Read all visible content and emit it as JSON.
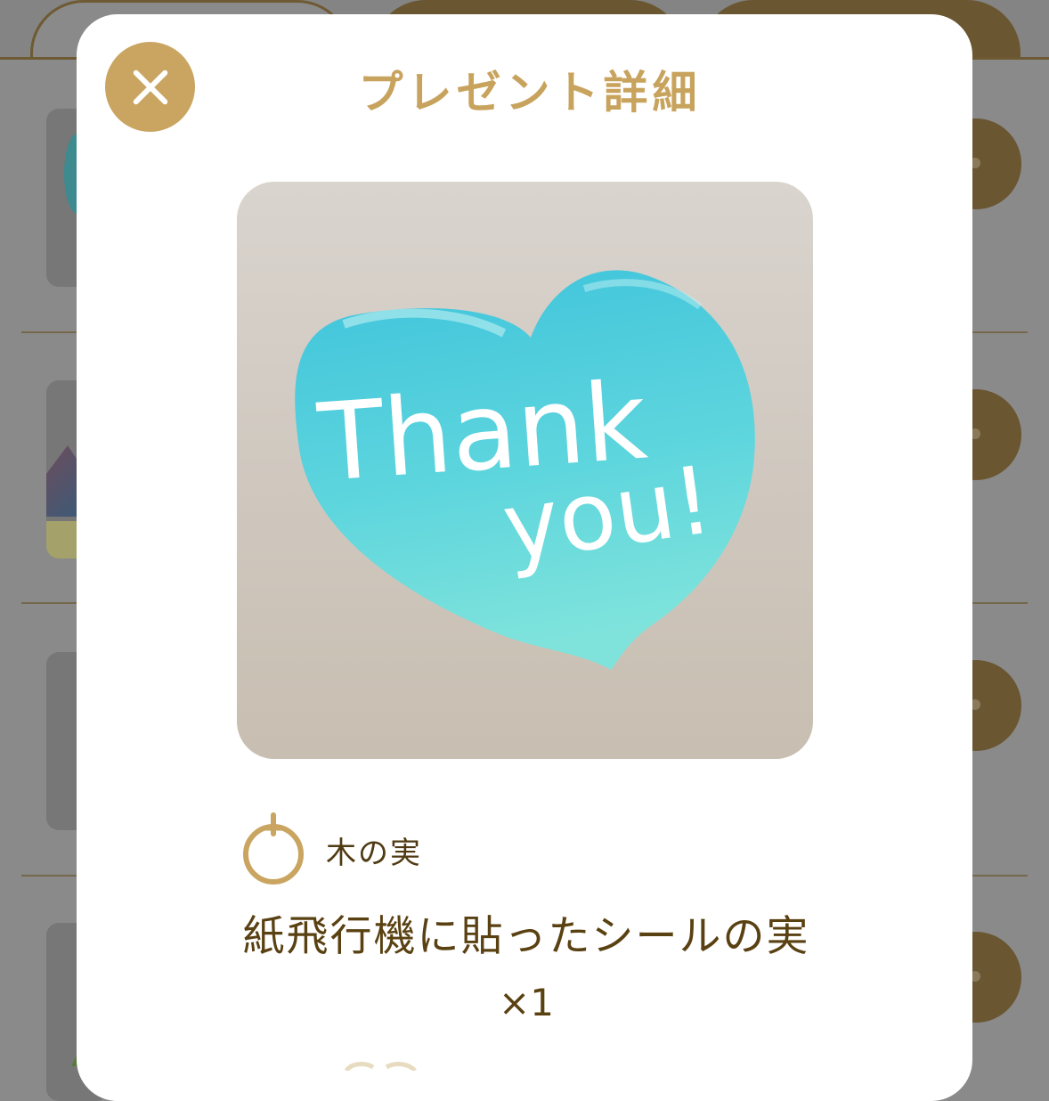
{
  "modal": {
    "title": "プレゼント詳細",
    "close_icon": "close-icon"
  },
  "item": {
    "image_alt": "Thank you!",
    "image_text_line1": "Thank",
    "image_text_line2": "you!",
    "category_icon": "fruit-icon",
    "category_label": "木の実",
    "name": "紙飛行機に貼ったシールの実",
    "quantity": "×1"
  },
  "colors": {
    "accent": "#c9a561",
    "title": "#c8a35d",
    "text": "#5a4112",
    "heart": "#56d2dd",
    "overlay": "#8a8a8a"
  }
}
